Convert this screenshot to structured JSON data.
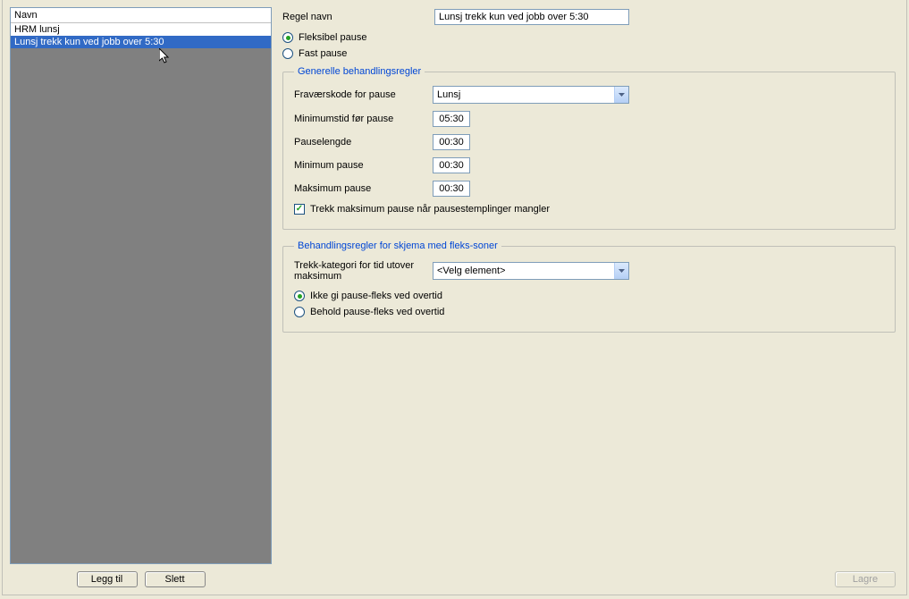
{
  "list": {
    "header": "Navn",
    "items": [
      "HRM lunsj",
      "Lunsj trekk kun ved jobb over 5:30"
    ],
    "selected_index": 1
  },
  "buttons": {
    "legg_til": "Legg til",
    "slett": "Slett",
    "lagre": "Lagre"
  },
  "form": {
    "regel_navn_label": "Regel navn",
    "regel_navn_value": "Lunsj trekk kun ved jobb over 5:30",
    "pause_type": {
      "fleksibel": "Fleksibel pause",
      "fast": "Fast pause",
      "selected": "fleksibel"
    }
  },
  "fs1": {
    "legend": "Generelle behandlingsregler",
    "fravaerskode_label": "Fraværskode for pause",
    "fravaerskode_value": "Lunsj",
    "min_tid_label": "Minimumstid før pause",
    "min_tid_value": "05:30",
    "pauselengde_label": "Pauselengde",
    "pauselengde_value": "00:30",
    "min_pause_label": "Minimum pause",
    "min_pause_value": "00:30",
    "max_pause_label": "Maksimum pause",
    "max_pause_value": "00:30",
    "trekk_max_label": "Trekk maksimum pause når pausestemplinger mangler",
    "trekk_max_checked": true
  },
  "fs2": {
    "legend": "Behandlingsregler for skjema med fleks-soner",
    "trekk_kategori_label": "Trekk-kategori for tid utover maksimum",
    "trekk_kategori_value": "<Velg element>",
    "overtid": {
      "ikke_gi": "Ikke gi pause-fleks ved overtid",
      "behold": "Behold pause-fleks ved overtid",
      "selected": "ikke_gi"
    }
  }
}
